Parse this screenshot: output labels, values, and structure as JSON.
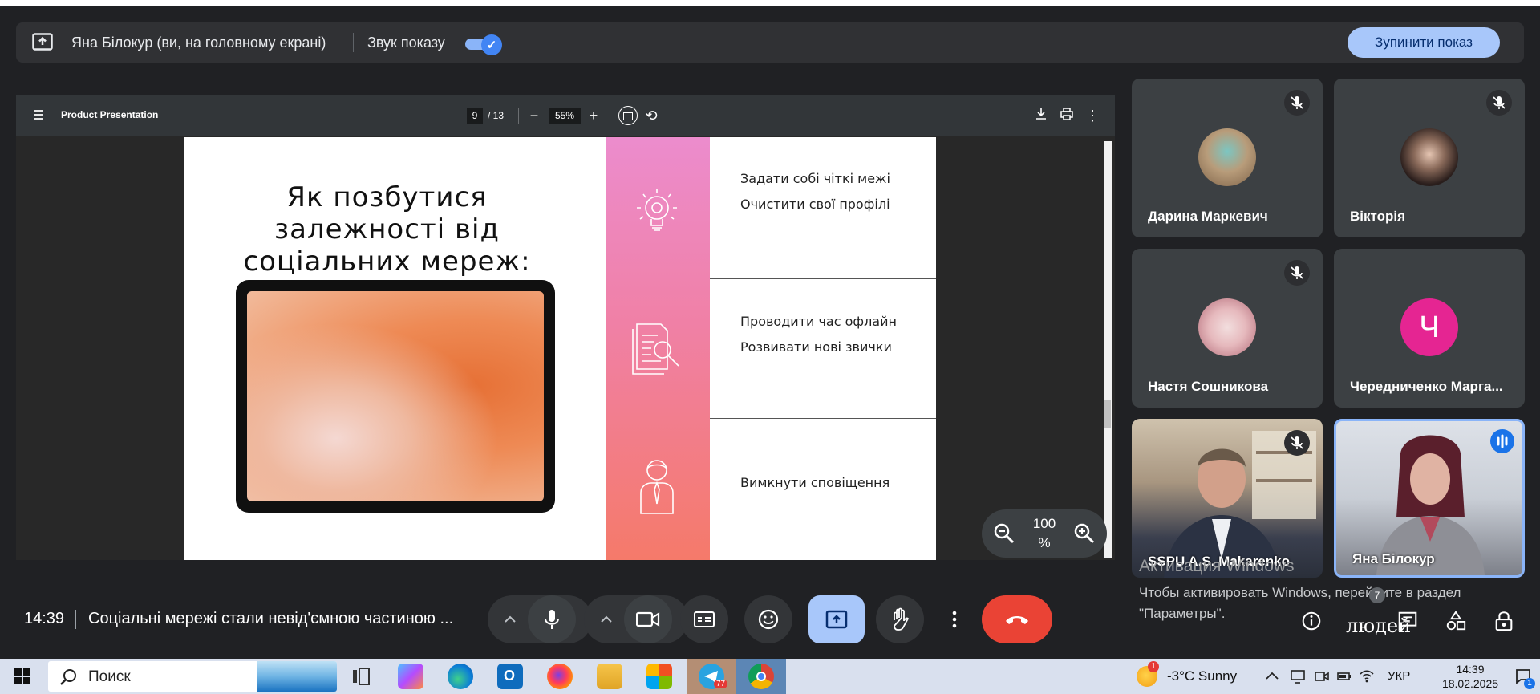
{
  "share_bar": {
    "presenter_text": "Яна Білокур (ви, на головному екрані)",
    "sound_label": "Звук показу",
    "sound_on": true,
    "stop_button": "Зупинити показ"
  },
  "pdf_viewer": {
    "title": "Product Presentation",
    "page_current": "9",
    "page_total": "/ 13",
    "zoom": "55%"
  },
  "slide": {
    "title": "Як позбутися залежності від соціальних мереж:",
    "rows": [
      {
        "icon": "lightbulb-gear-icon",
        "items": [
          "Задати собі чіткі межі",
          "Очистити свої профілі"
        ]
      },
      {
        "icon": "document-search-icon",
        "items": [
          "Проводити час офлайн",
          "Розвивати нові звички"
        ]
      },
      {
        "icon": "person-icon",
        "items": [
          "Вимкнути сповіщення"
        ]
      }
    ],
    "colors": {
      "strip_top": "#ec8ccd",
      "strip_bottom": "#f57a6a"
    }
  },
  "zoom_control": {
    "value_line1": "100",
    "value_line2": "%"
  },
  "participants": [
    {
      "name": "Дарина Маркевич",
      "muted": true,
      "kind": "photo-avatar"
    },
    {
      "name": "Вікторія",
      "muted": true,
      "kind": "photo-avatar"
    },
    {
      "name": "Настя Сошникова",
      "muted": true,
      "kind": "photo-avatar"
    },
    {
      "name": "Чередниченко Марга...",
      "muted": false,
      "kind": "letter-avatar",
      "letter": "Ч",
      "color": "#e52592"
    },
    {
      "name": "SSPU A.S. Makarenko",
      "muted": true,
      "kind": "video"
    },
    {
      "name": "Яна Білокур",
      "muted": false,
      "speaking": true,
      "kind": "video"
    }
  ],
  "watermark": {
    "title": "Активация Windows",
    "line": "Чтобы активировать Windows, перейдите в раздел \"Параметры\"."
  },
  "meeting": {
    "time": "14:39",
    "title": "Соціальні мережі стали невід'ємною частиною ...",
    "people_label": "людей",
    "people_count": "7"
  },
  "taskbar": {
    "search_label": "Поиск",
    "weather": "-3°C  Sunny",
    "weather_badge": "1",
    "telegram_badge": "77",
    "language": "УКР",
    "time": "14:39",
    "date": "18.02.2025",
    "notification_count": "1"
  }
}
